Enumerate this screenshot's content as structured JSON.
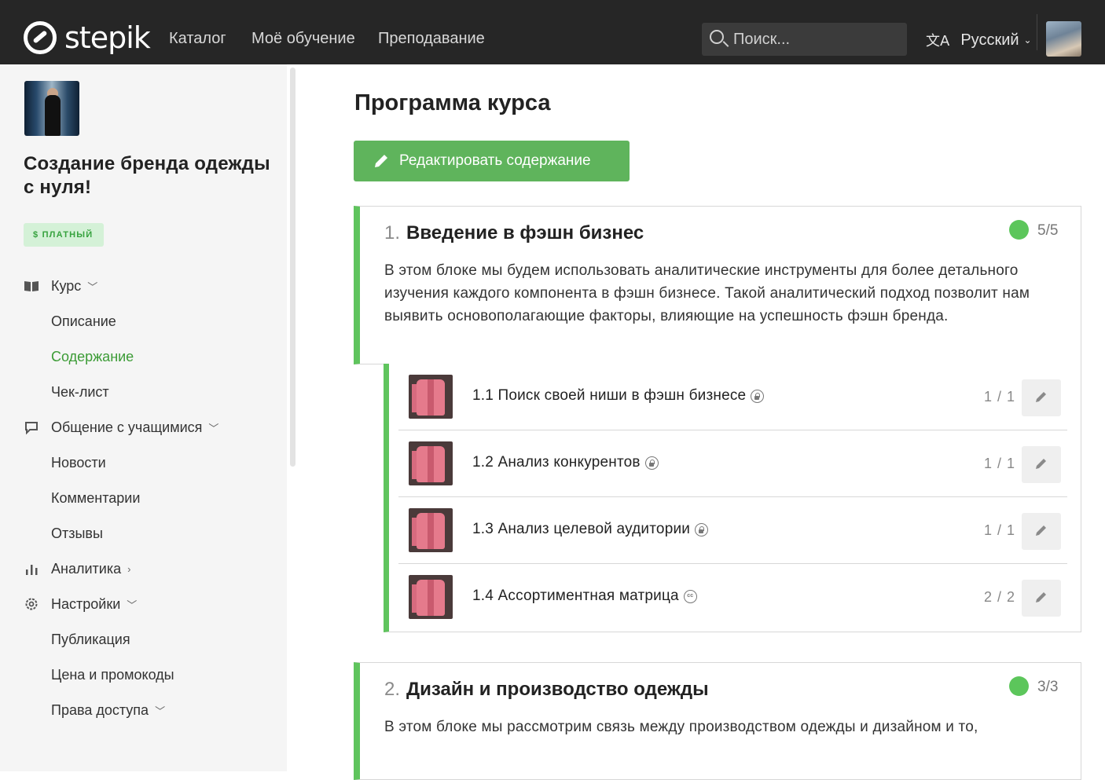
{
  "topbar": {
    "logo_text": "stepik",
    "nav": [
      "Каталог",
      "Моё обучение",
      "Преподавание"
    ],
    "search_placeholder": "Поиск...",
    "language": "Русский"
  },
  "sidebar": {
    "course_title": "Создание бренда одежды с нуля!",
    "badge": "$ ПЛАТНЫЙ",
    "course_label": "Курс",
    "description": "Описание",
    "content": "Содержание",
    "checklist": "Чек-лист",
    "communication": "Общение с учащимися",
    "news": "Новости",
    "comments": "Комментарии",
    "reviews": "Отзывы",
    "analytics": "Аналитика",
    "settings": "Настройки",
    "publication": "Публикация",
    "price": "Цена и промокоды",
    "access": "Права доступа"
  },
  "main": {
    "title": "Программа курса",
    "edit_button": "Редактировать содержание",
    "sections": [
      {
        "num": "1.",
        "title": "Введение в фэшн бизнес",
        "count": "5/5",
        "description": "В этом блоке мы будем использовать аналитические инструменты для более детального изучения каждого компонента в фэшн бизнесе. Такой аналитический подход позволит нам выявить основополагающие факторы, влияющие на успешность фэшн бренда.",
        "lessons": [
          {
            "title": "1.1 Поиск своей ниши в фэшн бизнесе",
            "count": "1 / 1",
            "icon": "lock-icon"
          },
          {
            "title": "1.2 Анализ конкурентов",
            "count": "1 / 1",
            "icon": "lock-icon"
          },
          {
            "title": "1.3 Анализ целевой аудитории",
            "count": "1 / 1",
            "icon": "lock-icon"
          },
          {
            "title": "1.4 Ассортиментная матрица",
            "count": "2 / 2",
            "icon": "cc-icon"
          }
        ]
      },
      {
        "num": "2.",
        "title": "Дизайн и производство одежды",
        "count": "3/3",
        "description": "В этом блоке мы рассмотрим связь между производством одежды и дизайном и то,"
      }
    ]
  },
  "colors": {
    "accent_green": "#5fb45c",
    "topbar": "#262626",
    "active_link": "#3b9b35"
  }
}
